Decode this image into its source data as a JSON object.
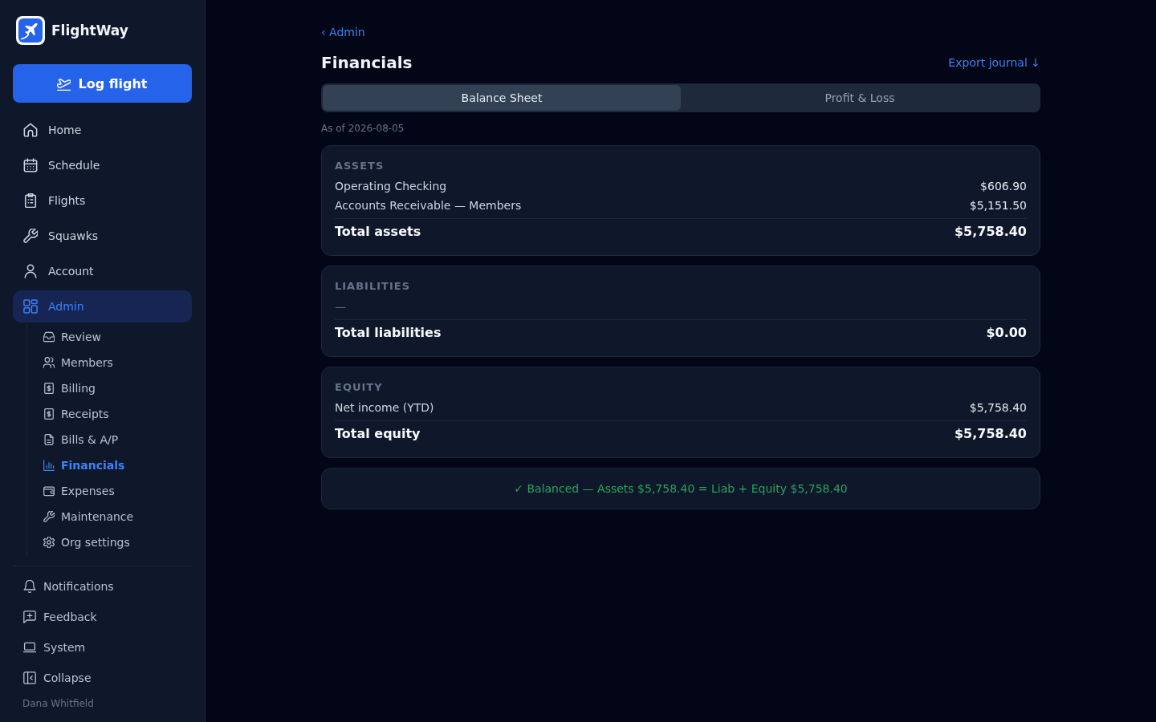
{
  "sidebar": {
    "brand": "FlightWay",
    "log_button": "Log flight",
    "nav": [
      {
        "label": "Home",
        "selected": false
      },
      {
        "label": "Schedule",
        "selected": false
      },
      {
        "label": "Flights",
        "selected": false
      },
      {
        "label": "Squawks",
        "selected": false
      },
      {
        "label": "Account",
        "selected": false
      },
      {
        "label": "Admin",
        "selected": true,
        "children": [
          {
            "label": "Review",
            "selected": false
          },
          {
            "label": "Members",
            "selected": false
          },
          {
            "label": "Billing",
            "selected": false
          },
          {
            "label": "Receipts",
            "selected": false
          },
          {
            "label": "Bills & A/P",
            "selected": false
          },
          {
            "label": "Financials",
            "selected": true
          },
          {
            "label": "Expenses",
            "selected": false
          },
          {
            "label": "Maintenance",
            "selected": false
          },
          {
            "label": "Org settings",
            "selected": false
          }
        ]
      }
    ],
    "footer": [
      {
        "label": "Notifications"
      },
      {
        "label": "Feedback"
      },
      {
        "label": "System"
      },
      {
        "label": "Collapse"
      }
    ],
    "user": "Dana Whitfield"
  },
  "main": {
    "back_link": "‹ Admin",
    "title": "Financials",
    "export_link": "Export journal ↓",
    "tabs": [
      {
        "label": "Balance Sheet",
        "selected": true
      },
      {
        "label": "Profit & Loss",
        "selected": false
      }
    ],
    "as_of": "As of 2026-08-05",
    "sections": [
      {
        "heading": "ASSETS",
        "rows": [
          {
            "label": "Operating Checking",
            "amount": "$606.90"
          },
          {
            "label": "Accounts Receivable — Members",
            "amount": "$5,151.50"
          }
        ],
        "total": {
          "label": "Total assets",
          "amount": "$5,758.40"
        }
      },
      {
        "heading": "LIABILITIES",
        "empty_text": "—",
        "total": {
          "label": "Total liabilities",
          "amount": "$0.00"
        }
      },
      {
        "heading": "EQUITY",
        "rows": [
          {
            "label": "Net income (YTD)",
            "amount": "$5,758.40"
          }
        ],
        "total": {
          "label": "Total equity",
          "amount": "$5,758.40"
        }
      }
    ],
    "balance_check": {
      "balanced": true,
      "text": "✓ Balanced — Assets $5,758.40 = Liab + Equity $5,758.40"
    }
  }
}
